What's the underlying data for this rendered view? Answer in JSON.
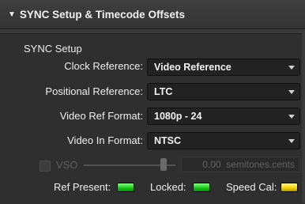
{
  "header": {
    "title": "SYNC Setup & Timecode Offsets"
  },
  "section": {
    "title": "SYNC Setup"
  },
  "fields": {
    "clock_reference": {
      "label": "Clock Reference:",
      "value": "Video Reference"
    },
    "positional_reference": {
      "label": "Positional Reference:",
      "value": "LTC"
    },
    "video_ref_format": {
      "label": "Video Ref Format:",
      "value": "1080p - 24"
    },
    "video_in_format": {
      "label": "Video In Format:",
      "value": "NTSC"
    }
  },
  "vso": {
    "label": "VSO",
    "value": "0.00",
    "unit": "semitones.cents",
    "enabled": false
  },
  "status": {
    "ref_present": {
      "label": "Ref Present:",
      "color": "#1ec41e"
    },
    "locked": {
      "label": "Locked:",
      "color": "#1ec41e"
    },
    "speed_cal": {
      "label": "Speed Cal:",
      "color": "#f0d000"
    }
  }
}
